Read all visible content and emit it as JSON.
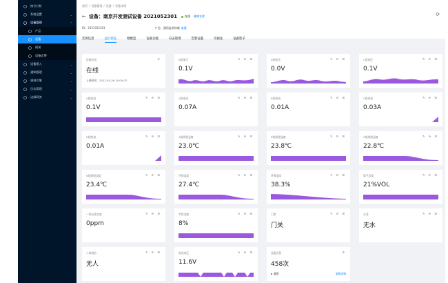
{
  "sidebar": {
    "items": [
      {
        "label": "统计分析",
        "icon": "chart-icon",
        "chevron": "",
        "state": ""
      },
      {
        "label": "系统设置",
        "icon": "gear-icon",
        "chevron": "⌄",
        "state": ""
      },
      {
        "label": "设备管理",
        "icon": "device-icon",
        "chevron": "⌃",
        "state": "open"
      },
      {
        "label": "产品",
        "icon": "product-icon",
        "chevron": "",
        "state": "sub"
      },
      {
        "label": "设备",
        "icon": "device-sub-icon",
        "chevron": "",
        "state": "sub active"
      },
      {
        "label": "网关",
        "icon": "gateway-icon",
        "chevron": "",
        "state": "sub"
      },
      {
        "label": "设备告警",
        "icon": "alarm-icon",
        "chevron": "",
        "state": "sub"
      },
      {
        "label": "设备接入",
        "icon": "access-icon",
        "chevron": "⌄",
        "state": ""
      },
      {
        "label": "通知管理",
        "icon": "bell-icon",
        "chevron": "⌄",
        "state": ""
      },
      {
        "label": "规则引擎",
        "icon": "rule-icon",
        "chevron": "⌄",
        "state": ""
      },
      {
        "label": "日志管理",
        "icon": "log-icon",
        "chevron": "⌄",
        "state": ""
      },
      {
        "label": "边缘网关",
        "icon": "edge-icon",
        "chevron": "⌄",
        "state": ""
      }
    ]
  },
  "header": {
    "breadcrumb": [
      "首页",
      "/",
      "设备管理",
      "/",
      "设备",
      "/",
      "设备详情"
    ],
    "back_icon": "arrow-left-icon",
    "title": "设备：南京开发测试设备 2021052301",
    "status": "在线",
    "status_color": "#52c41a",
    "rename": "编辑名称",
    "id_text": "ID：2021052301",
    "product_label": "产品：通用监测终端",
    "product_link": "查看"
  },
  "tabs": [
    "实例信息",
    "运行状态",
    "物模型",
    "设备功能",
    "日志管理",
    "告警设置",
    "可视化",
    "设备影子"
  ],
  "active_tab": 1,
  "accent_color": "#1890ff",
  "chart_color": "#9b59e0",
  "cards": [
    {
      "label": "设备状态",
      "value": "在线",
      "sub": "上线时间：2021-05-26 10:05:07",
      "chart": "none",
      "actions": "⟳"
    },
    {
      "label": "A相电压",
      "value": "0.1V",
      "chart": "wave1",
      "actions": "✎ ⟳ ☰"
    },
    {
      "label": "B相电压",
      "value": "0.0V",
      "chart": "wave2",
      "actions": "✎ ⟳ ☰"
    },
    {
      "label": "C相电压",
      "value": "0.1V",
      "chart": "wave3",
      "actions": "✎ ⟳ ☰"
    },
    {
      "label": "A相电流",
      "value": "0.1V",
      "chart": "flat",
      "actions": "✎ ⟳ ☰"
    },
    {
      "label": "A相电流",
      "value": "0.07A",
      "chart": "none",
      "actions": "✎ ⟳ ☰"
    },
    {
      "label": "B相电流",
      "value": "0.01A",
      "chart": "none",
      "actions": "✎ ⟳ ☰"
    },
    {
      "label": "C相电流",
      "value": "0.03A",
      "chart": "tri",
      "actions": "✎ ⟳ ☰"
    },
    {
      "label": "N相电流",
      "value": "0.01A",
      "chart": "tri",
      "actions": "✎ ⟳ ☰"
    },
    {
      "label": "A相线缆温度",
      "value": "23.0℃",
      "chart": "flat",
      "actions": "✎ ⟳ ☰"
    },
    {
      "label": "B相线缆温度",
      "value": "23.8℃",
      "chart": "flat",
      "actions": "✎ ⟳ ☰"
    },
    {
      "label": "C相线缆温度",
      "value": "22.8℃",
      "chart": "drop",
      "actions": "✎ ⟳ ☰"
    },
    {
      "label": "N相线缆温度",
      "value": "23.4℃",
      "chart": "drop",
      "actions": "✎ ⟳ ☰"
    },
    {
      "label": "环境温度",
      "value": "27.4℃",
      "chart": "drop",
      "actions": "✎ ⟳ ☰"
    },
    {
      "label": "环境湿度",
      "value": "38.3%",
      "chart": "slope",
      "actions": "✎ ⟳ ☰"
    },
    {
      "label": "氧气浓度",
      "value": "21%VOL",
      "chart": "flat",
      "actions": "✎ ⟳ ☰"
    },
    {
      "label": "一氧化碳浓度",
      "value": "0ppm",
      "chart": "none",
      "actions": "✎ ⟳ ☰"
    },
    {
      "label": "甲烷浓度",
      "value": "8%",
      "chart": "flat",
      "actions": "✎ ⟳ ☰"
    },
    {
      "label": "门禁",
      "value": "门关",
      "chart": "none",
      "actions": "✎ ⟳ ☰"
    },
    {
      "label": "水浸",
      "value": "无水",
      "chart": "none",
      "actions": "✎ ⟳ ☰"
    },
    {
      "label": "人体感应",
      "value": "无人",
      "chart": "none",
      "actions": "✎ ⟳ ☰"
    },
    {
      "label": "电池电压",
      "value": "11.6V",
      "chart": "spikes",
      "actions": "✎ ⟳ ☰"
    },
    {
      "label": "设备告警",
      "value": "458次",
      "chart": "none",
      "actions": "⟳",
      "footer_left": "紧急",
      "footer_right": "查看详情"
    },
    {
      "label": "",
      "value": "",
      "chart": "none",
      "actions": "",
      "hidden": true
    }
  ]
}
